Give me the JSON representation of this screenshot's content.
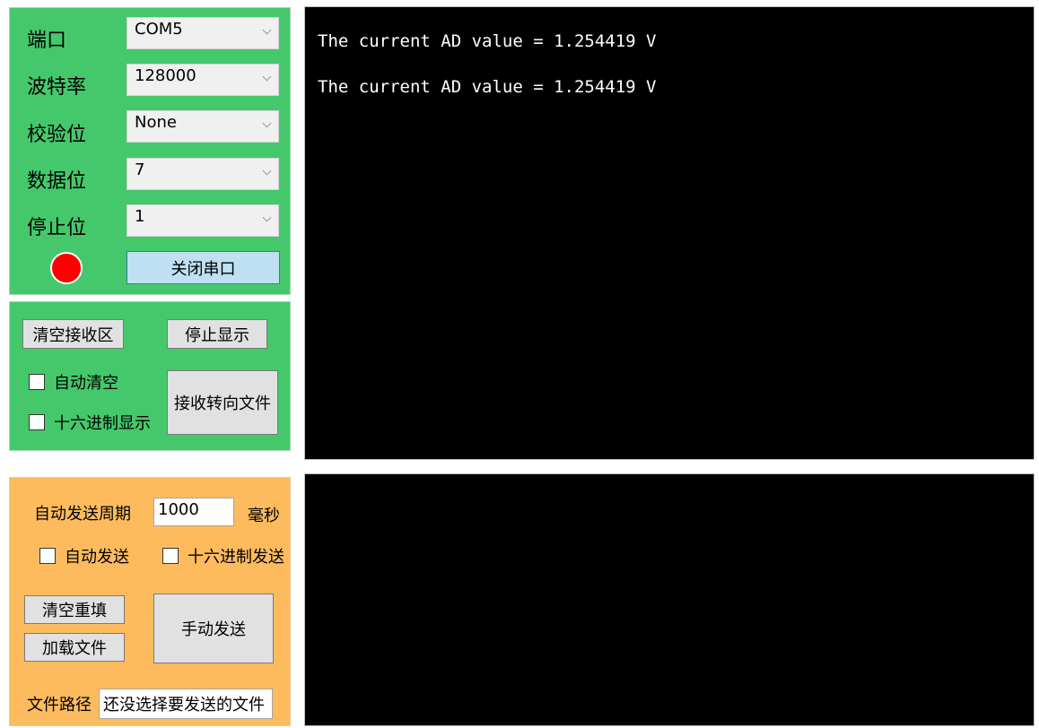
{
  "serial": {
    "port": {
      "label": "端口",
      "value": "COM5"
    },
    "baud": {
      "label": "波特率",
      "value": "128000"
    },
    "parity": {
      "label": "校验位",
      "value": "None"
    },
    "databits": {
      "label": "数据位",
      "value": "7"
    },
    "stopbits": {
      "label": "停止位",
      "value": "1"
    },
    "status_color": "#ff0000",
    "toggle_label": "关闭串口"
  },
  "receive": {
    "clear_label": "清空接收区",
    "stop_label": "停止显示",
    "auto_clear_label": "自动清空",
    "hex_display_label": "十六进制显示",
    "redirect_label": "接收转向文件",
    "lines": [
      "The current AD value = 1.254419 V",
      "The current AD value = 1.254419 V"
    ]
  },
  "send": {
    "period_label": "自动发送周期",
    "period_value": "1000",
    "period_unit": "毫秒",
    "auto_send_label": "自动发送",
    "hex_send_label": "十六进制发送",
    "clear_refill_label": "清空重填",
    "load_file_label": "加载文件",
    "manual_send_label": "手动发送",
    "file_path_label": "文件路径",
    "file_path_value": "还没选择要发送的文件"
  },
  "colors": {
    "serial_panel": "#45c86b",
    "send_panel": "#fdbb5e",
    "terminal_bg": "#000000",
    "terminal_text": "#ffffff"
  }
}
